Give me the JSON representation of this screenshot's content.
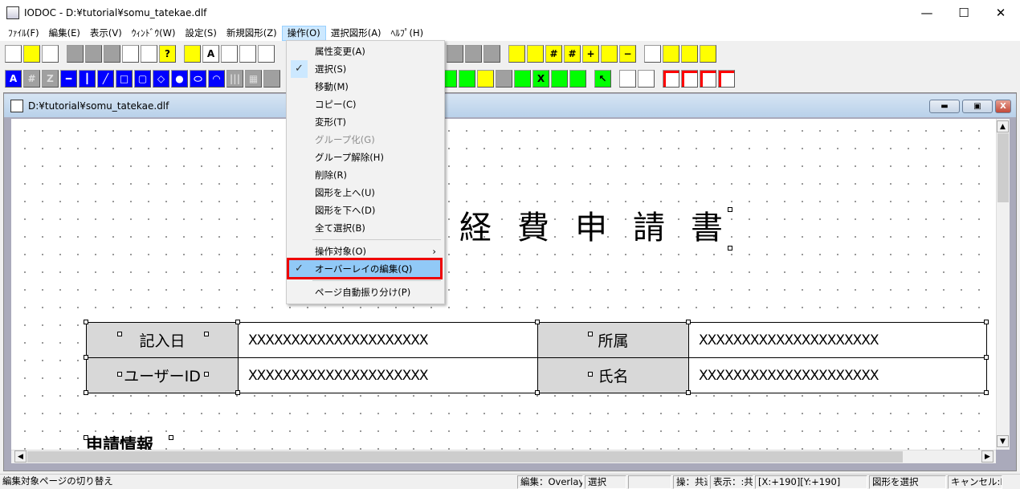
{
  "window": {
    "title": "IODOC - D:¥tutorial¥somu_tatekae.dlf",
    "minimize": "—",
    "maximize": "☐",
    "close": "✕"
  },
  "menu": [
    "ﾌｧｲﾙ(F)",
    "編集(E)",
    "表示(V)",
    "ｳｨﾝﾄﾞｳ(W)",
    "設定(S)",
    "新規図形(Z)",
    "操作(O)",
    "選択図形(A)",
    "ﾍﾙﾌﾟ(H)"
  ],
  "toolbar1": [
    [
      "new-file-icon",
      "",
      "n"
    ],
    [
      "open-folder-icon",
      "",
      "yellow"
    ],
    [
      "save-icon",
      "",
      "n"
    ],
    [
      "sep"
    ],
    [
      "copy-icon",
      "",
      "gray"
    ],
    [
      "paste-icon",
      "",
      "gray"
    ],
    [
      "spell-icon",
      "",
      "gray"
    ],
    [
      "copy-page-icon",
      "",
      "n"
    ],
    [
      "document-icon",
      "",
      "n"
    ],
    [
      "help-icon",
      "?",
      "yellow"
    ],
    [
      "sep"
    ],
    [
      "shape-window-icon",
      "",
      "yellow"
    ],
    [
      "text-window-icon",
      "A",
      "n"
    ],
    [
      "zoom-window-icon",
      "",
      "n"
    ],
    [
      "page-window-icon",
      "",
      "n"
    ],
    [
      "list-window-icon",
      "",
      "n"
    ]
  ],
  "toolbar1b": [
    [
      "align-icon",
      "",
      "gray"
    ],
    [
      "gray-icon",
      "",
      "gray"
    ],
    [
      "arrange-icon",
      "",
      "gray"
    ],
    [
      "sep"
    ],
    [
      "grid-number-icon",
      "",
      "yellow"
    ],
    [
      "grid-z-icon",
      "",
      "yellow"
    ],
    [
      "grid-black-icon",
      "#",
      "yellow"
    ],
    [
      "grid-yellow-icon",
      "#",
      "yellow"
    ],
    [
      "zoom-in-icon",
      "+",
      "yellow"
    ],
    [
      "page-icon",
      "",
      "yellow"
    ],
    [
      "zoom-out-icon",
      "−",
      "yellow"
    ],
    [
      "sep"
    ],
    [
      "layer1-icon",
      "",
      "n"
    ],
    [
      "layer2-icon",
      "",
      "yellow"
    ],
    [
      "layer3-icon",
      "",
      "yellow"
    ],
    [
      "layer4-icon",
      "",
      "yellow"
    ]
  ],
  "toolbar2": [
    [
      "text-tool-icon",
      "A",
      "blue"
    ],
    [
      "number-tool-icon",
      "#",
      "gray"
    ],
    [
      "zip-tool-icon",
      "Z",
      "gray"
    ],
    [
      "hline-tool-icon",
      "━",
      "blue"
    ],
    [
      "vline-tool-icon",
      "┃",
      "blue"
    ],
    [
      "diagonal-tool-icon",
      "╱",
      "blue"
    ],
    [
      "rect-tool-icon",
      "□",
      "blue"
    ],
    [
      "round-rect-tool-icon",
      "▢",
      "blue"
    ],
    [
      "diamond-tool-icon",
      "◇",
      "blue"
    ],
    [
      "circle-tool-icon",
      "●",
      "blue"
    ],
    [
      "ellipse-tool-icon",
      "⬭",
      "blue"
    ],
    [
      "arc-tool-icon",
      "◠",
      "blue"
    ],
    [
      "barcode-tool-icon",
      "|||",
      "gray"
    ],
    [
      "qr-tool-icon",
      "▦",
      "gray"
    ],
    [
      "image-tool-icon",
      "",
      "gray"
    ]
  ],
  "toolbar2b": [
    [
      "resize-icon",
      "",
      "green"
    ],
    [
      "distribute-icon",
      "",
      "green"
    ],
    [
      "select-frame-icon",
      "",
      "yellow"
    ],
    [
      "disabled-icon",
      "",
      "gray"
    ],
    [
      "group-icon",
      "",
      "green"
    ],
    [
      "cross-icon",
      "X",
      "green"
    ],
    [
      "front-icon",
      "",
      "green"
    ],
    [
      "back-icon",
      "",
      "green"
    ],
    [
      "sep"
    ],
    [
      "pointer-icon",
      "↖",
      "green"
    ],
    [
      "sep"
    ],
    [
      "link-icon",
      "",
      "n"
    ],
    [
      "link2-icon",
      "",
      "n"
    ],
    [
      "sep"
    ],
    [
      "red-layer1-icon",
      "",
      "red"
    ],
    [
      "red-layer2-icon",
      "",
      "red"
    ],
    [
      "red-layer3-icon",
      "",
      "red"
    ],
    [
      "red-layer4-icon",
      "",
      "red"
    ]
  ],
  "child": {
    "title": "D:¥tutorial¥somu_tatekae.dlf",
    "minimize": "▬",
    "restore": "▣",
    "close": "X"
  },
  "document": {
    "title": "経費申請書",
    "section": "申請情報",
    "rows": [
      [
        "記入日",
        "XXXXXXXXXXXXXXXXXXXXX",
        "所属",
        "XXXXXXXXXXXXXXXXXXXXX"
      ],
      [
        "ユーザーID",
        "XXXXXXXXXXXXXXXXXXXXX",
        "氏名",
        "XXXXXXXXXXXXXXXXXXXXX"
      ]
    ]
  },
  "dropdown": [
    {
      "label": "属性変更(A)"
    },
    {
      "label": "選択(S)",
      "checked": "✓"
    },
    {
      "label": "移動(M)"
    },
    {
      "label": "コピー(C)"
    },
    {
      "label": "変形(T)"
    },
    {
      "label": "グループ化(G)",
      "disabled": true
    },
    {
      "label": "グループ解除(H)"
    },
    {
      "label": "削除(R)"
    },
    {
      "label": "図形を上へ(U)"
    },
    {
      "label": "図形を下へ(D)"
    },
    {
      "label": "全て選択(B)"
    },
    {
      "sep": true
    },
    {
      "label": "操作対象(O)",
      "submenu": "›"
    },
    {
      "label": "オーバーレイの編集(Q)",
      "checked": "✓",
      "selected": true
    },
    {
      "sep": true
    },
    {
      "label": "ページ自動振り分け(P)"
    }
  ],
  "status": [
    "編集対象ページの切り替え",
    "編集：Overlay",
    "選択",
    "",
    "操：共通",
    "表示：:共",
    "[X:+190][Y:+190]",
    "図形を選択",
    "キャンセル:R"
  ]
}
